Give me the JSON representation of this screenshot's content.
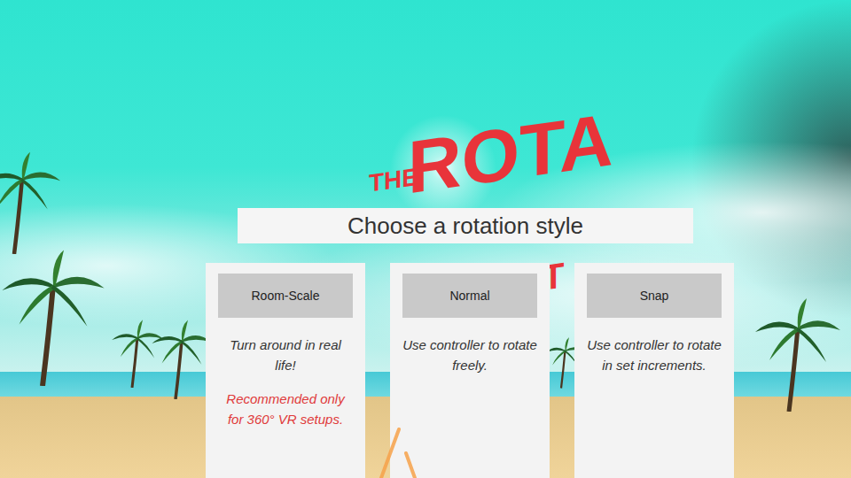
{
  "logo": {
    "top": "THE",
    "main": "ROTA",
    "tail": "T"
  },
  "menu": {
    "title": "Choose a rotation style",
    "options": [
      {
        "label": "Room-Scale",
        "description": "Turn around in real life!",
        "note": "Recommended only for 360° VR setups.",
        "selected": false
      },
      {
        "label": "Normal",
        "description": "Use controller to rotate freely.",
        "note": "",
        "selected": false
      },
      {
        "label": "Snap",
        "description": "Use controller to rotate in set increments.",
        "note": "",
        "selected": false
      }
    ]
  }
}
